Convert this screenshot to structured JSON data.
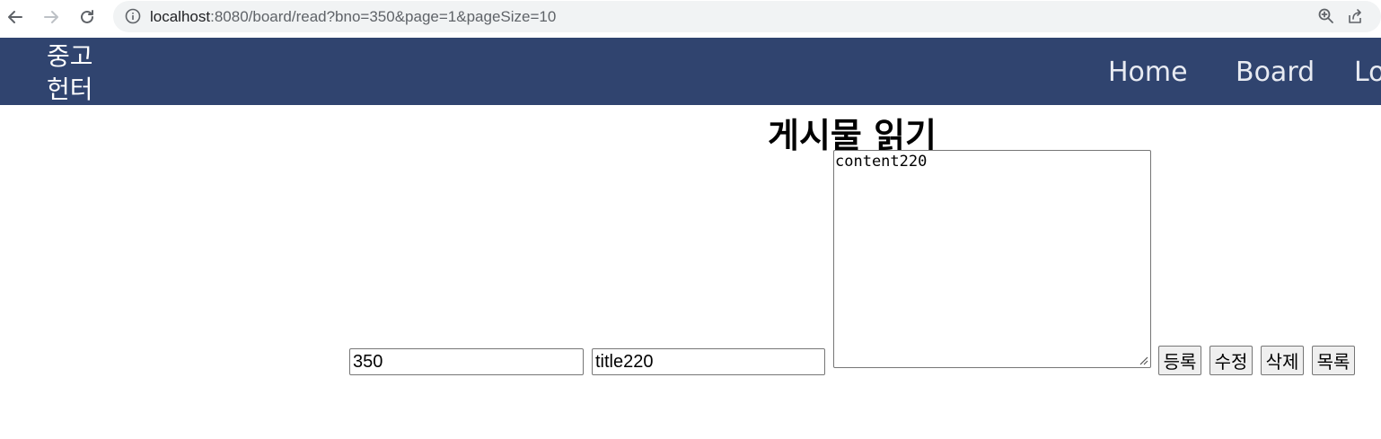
{
  "browser": {
    "url_host": "localhost",
    "url_rest": ":8080/board/read?bno=350&page=1&pageSize=10"
  },
  "header": {
    "brand": "중고 헌터",
    "menu": [
      {
        "label": "Home"
      },
      {
        "label": "Board"
      },
      {
        "label": "Lo"
      }
    ]
  },
  "main": {
    "title": "게시물 읽기",
    "bno": "350",
    "post_title": "title220",
    "content": "content220",
    "buttons": {
      "register": "등록",
      "modify": "수정",
      "delete": "삭제",
      "list": "목록"
    }
  },
  "colors": {
    "header_bg": "#30446f",
    "url_bar_bg": "#f1f3f4"
  }
}
